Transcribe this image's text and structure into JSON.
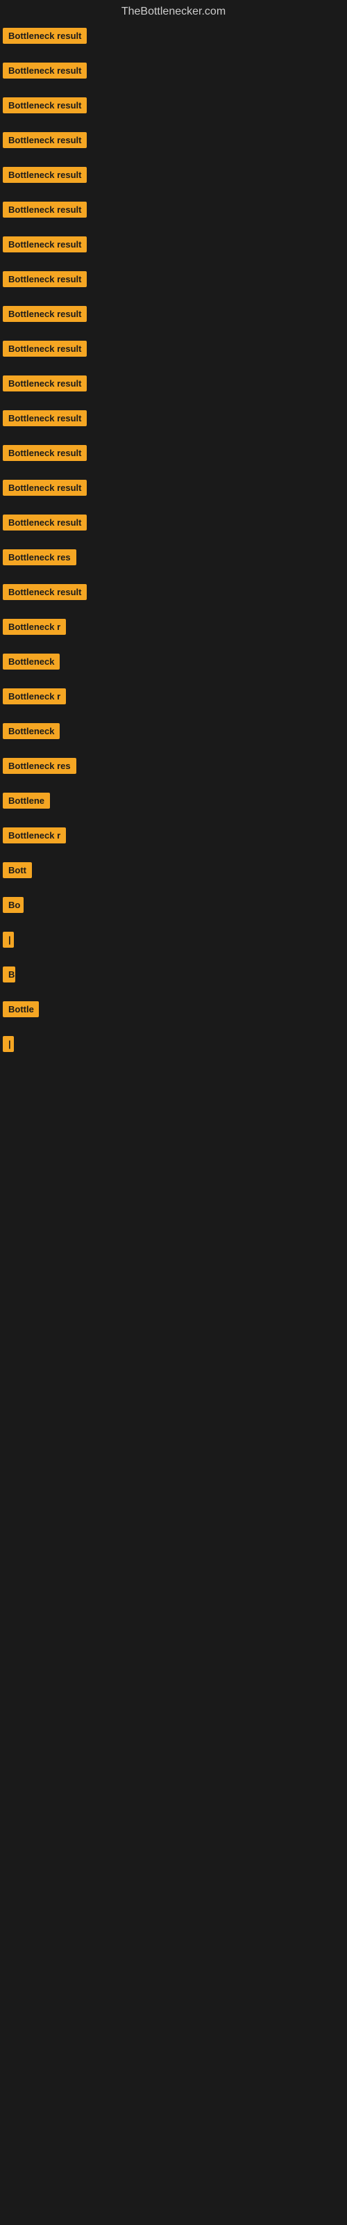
{
  "header": {
    "title": "TheBottlenecker.com"
  },
  "items": [
    {
      "label": "Bottleneck result",
      "width": 155
    },
    {
      "label": "Bottleneck result",
      "width": 155
    },
    {
      "label": "Bottleneck result",
      "width": 155
    },
    {
      "label": "Bottleneck result",
      "width": 155
    },
    {
      "label": "Bottleneck result",
      "width": 155
    },
    {
      "label": "Bottleneck result",
      "width": 155
    },
    {
      "label": "Bottleneck result",
      "width": 155
    },
    {
      "label": "Bottleneck result",
      "width": 155
    },
    {
      "label": "Bottleneck result",
      "width": 155
    },
    {
      "label": "Bottleneck result",
      "width": 155
    },
    {
      "label": "Bottleneck result",
      "width": 155
    },
    {
      "label": "Bottleneck result",
      "width": 155
    },
    {
      "label": "Bottleneck result",
      "width": 155
    },
    {
      "label": "Bottleneck result",
      "width": 155
    },
    {
      "label": "Bottleneck result",
      "width": 155
    },
    {
      "label": "Bottleneck res",
      "width": 122
    },
    {
      "label": "Bottleneck result",
      "width": 148
    },
    {
      "label": "Bottleneck r",
      "width": 105
    },
    {
      "label": "Bottleneck",
      "width": 90
    },
    {
      "label": "Bottleneck r",
      "width": 100
    },
    {
      "label": "Bottleneck",
      "width": 88
    },
    {
      "label": "Bottleneck res",
      "width": 118
    },
    {
      "label": "Bottlene",
      "width": 78
    },
    {
      "label": "Bottleneck r",
      "width": 100
    },
    {
      "label": "Bott",
      "width": 45
    },
    {
      "label": "Bo",
      "width": 30
    },
    {
      "label": "|",
      "width": 12
    },
    {
      "label": "B",
      "width": 18
    },
    {
      "label": "Bottle",
      "width": 52
    },
    {
      "label": "|",
      "width": 10
    }
  ]
}
